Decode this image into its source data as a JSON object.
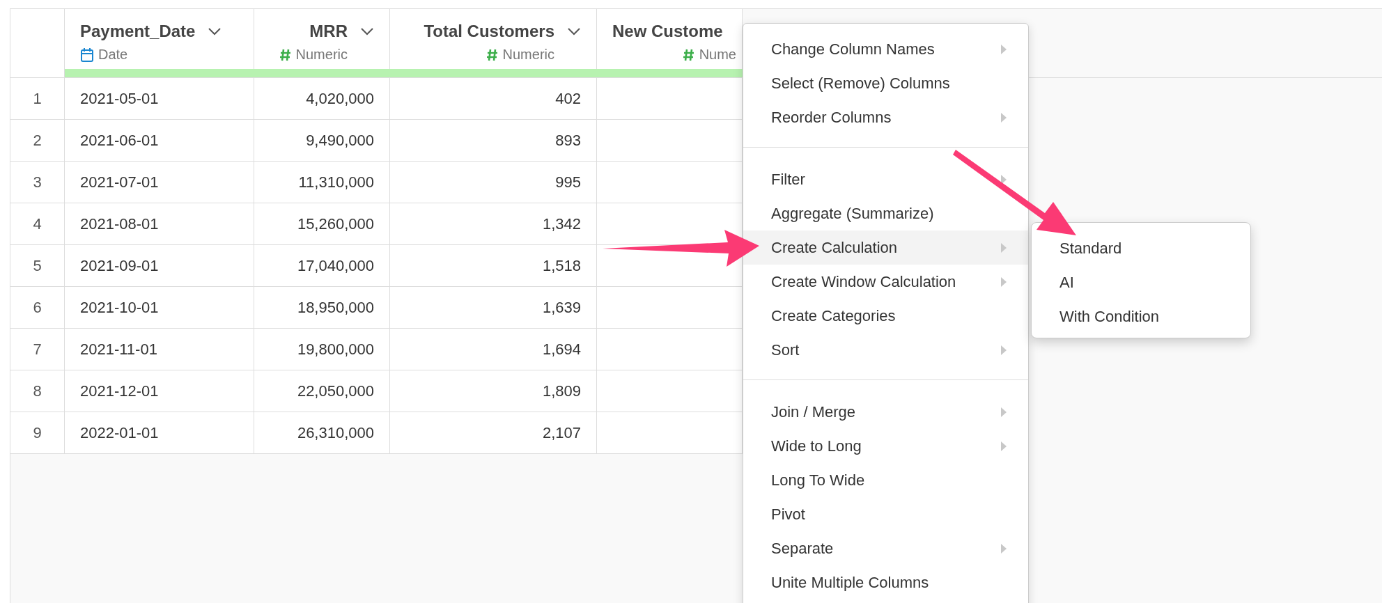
{
  "table": {
    "columns": [
      {
        "title": "Payment_Date",
        "type": "Date",
        "kind": "date"
      },
      {
        "title": "MRR",
        "type": "Numeric",
        "kind": "numeric"
      },
      {
        "title": "Total Customers",
        "type": "Numeric",
        "kind": "numeric"
      },
      {
        "title": "New Custome",
        "type": "Nume",
        "kind": "numeric"
      }
    ],
    "rows": [
      {
        "index": "1",
        "cells": [
          "2021-05-01",
          "4,020,000",
          "402"
        ]
      },
      {
        "index": "2",
        "cells": [
          "2021-06-01",
          "9,490,000",
          "893"
        ]
      },
      {
        "index": "3",
        "cells": [
          "2021-07-01",
          "11,310,000",
          "995"
        ]
      },
      {
        "index": "4",
        "cells": [
          "2021-08-01",
          "15,260,000",
          "1,342"
        ]
      },
      {
        "index": "5",
        "cells": [
          "2021-09-01",
          "17,040,000",
          "1,518"
        ]
      },
      {
        "index": "6",
        "cells": [
          "2021-10-01",
          "18,950,000",
          "1,639"
        ]
      },
      {
        "index": "7",
        "cells": [
          "2021-11-01",
          "19,800,000",
          "1,694"
        ]
      },
      {
        "index": "8",
        "cells": [
          "2021-12-01",
          "22,050,000",
          "1,809"
        ]
      },
      {
        "index": "9",
        "cells": [
          "2022-01-01",
          "26,310,000",
          "2,107"
        ]
      }
    ]
  },
  "context_menu": {
    "groups": [
      [
        {
          "label": "Change Column Names",
          "has_submenu": true,
          "selected": false
        },
        {
          "label": "Select (Remove) Columns",
          "has_submenu": false,
          "selected": false
        },
        {
          "label": "Reorder Columns",
          "has_submenu": true,
          "selected": false
        }
      ],
      [
        {
          "label": "Filter",
          "has_submenu": true,
          "selected": false
        },
        {
          "label": "Aggregate (Summarize)",
          "has_submenu": false,
          "selected": false
        },
        {
          "label": "Create Calculation",
          "has_submenu": true,
          "selected": true
        },
        {
          "label": "Create Window Calculation",
          "has_submenu": true,
          "selected": false
        },
        {
          "label": "Create Categories",
          "has_submenu": false,
          "selected": false
        },
        {
          "label": "Sort",
          "has_submenu": true,
          "selected": false
        }
      ],
      [
        {
          "label": "Join / Merge",
          "has_submenu": true,
          "selected": false
        },
        {
          "label": "Wide to Long",
          "has_submenu": true,
          "selected": false
        },
        {
          "label": "Long To Wide",
          "has_submenu": false,
          "selected": false
        },
        {
          "label": "Pivot",
          "has_submenu": false,
          "selected": false
        },
        {
          "label": "Separate",
          "has_submenu": true,
          "selected": false
        },
        {
          "label": "Unite Multiple Columns",
          "has_submenu": false,
          "selected": false
        }
      ]
    ]
  },
  "submenu": {
    "items": [
      {
        "label": "Standard"
      },
      {
        "label": "AI"
      },
      {
        "label": "With Condition"
      }
    ]
  }
}
